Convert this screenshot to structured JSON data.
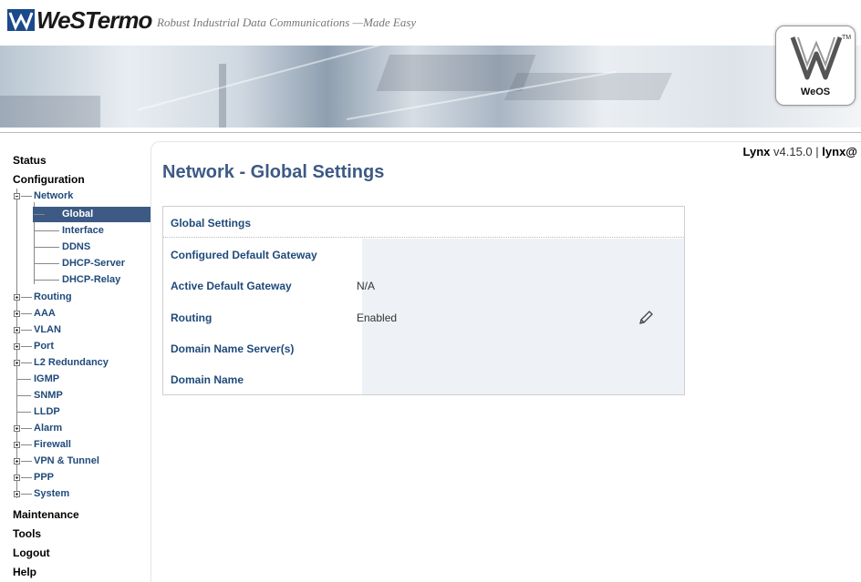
{
  "header": {
    "brand": "WeSTermo",
    "tagline": "Robust Industrial Data Communications —Made Easy",
    "badge_text": "WeOS",
    "tm_mark": "TM"
  },
  "sidebar": {
    "top_items": [
      {
        "label": "Status"
      },
      {
        "label": "Configuration"
      },
      {
        "label": "Maintenance"
      },
      {
        "label": "Tools"
      },
      {
        "label": "Logout"
      },
      {
        "label": "Help"
      }
    ],
    "network": "Network",
    "network_children": [
      "Global",
      "Interface",
      "DDNS",
      "DHCP-Server",
      "DHCP-Relay"
    ],
    "config_children": [
      "Routing",
      "AAA",
      "VLAN",
      "Port",
      "L2 Redundancy",
      "IGMP",
      "SNMP",
      "LLDP",
      "Alarm",
      "Firewall",
      "VPN & Tunnel",
      "PPP",
      "System"
    ]
  },
  "device_info": {
    "model": "Lynx",
    "version": "v4.15.0",
    "separator": "|",
    "host": "lynx@"
  },
  "page": {
    "title": "Network - Global Settings"
  },
  "panel": {
    "heading": "Global Settings",
    "rows": [
      {
        "label": "Configured Default Gateway",
        "value": ""
      },
      {
        "label": "Active Default Gateway",
        "value": "N/A"
      },
      {
        "label": "Routing",
        "value": "Enabled"
      },
      {
        "label": "Domain Name Server(s)",
        "value": ""
      },
      {
        "label": "Domain Name",
        "value": ""
      }
    ]
  },
  "colors": {
    "accent": "#3d5a85",
    "label": "#1f4a7a",
    "panel_bg": "#eef1f5"
  }
}
